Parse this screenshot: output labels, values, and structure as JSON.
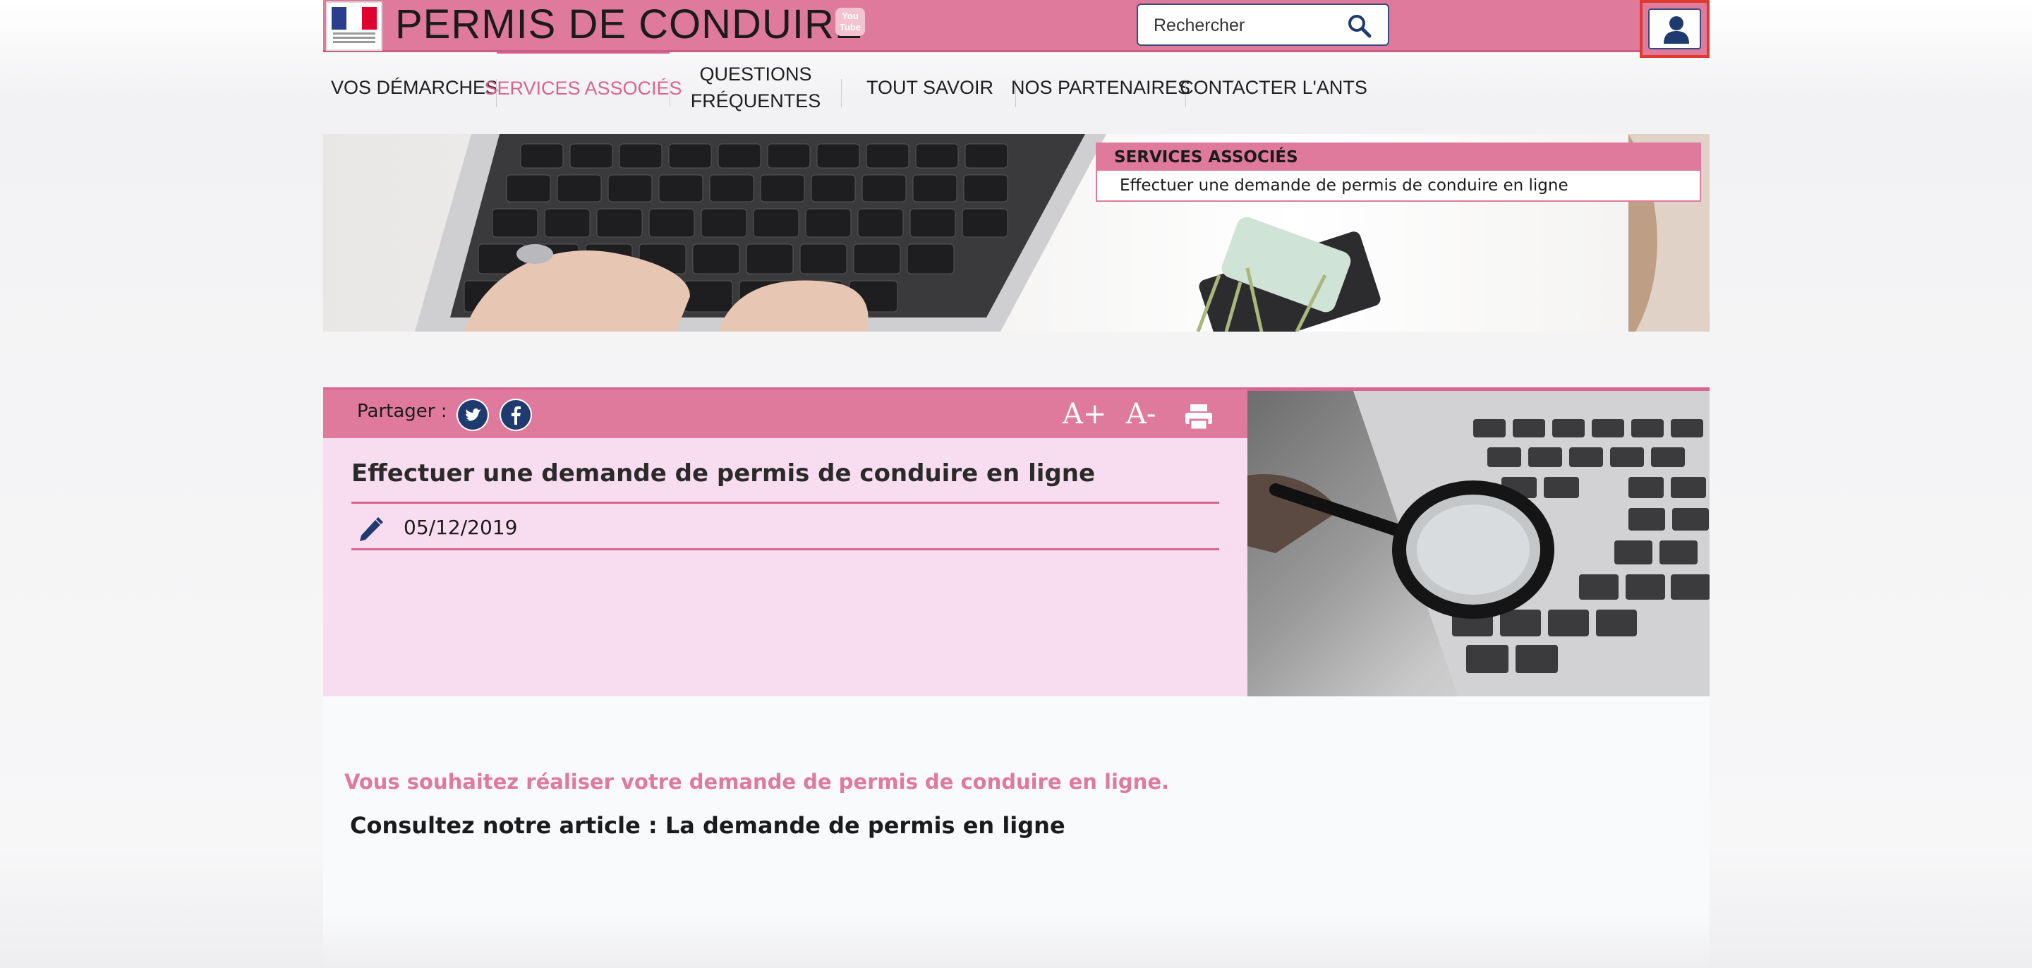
{
  "header": {
    "logo_alt": "Agence Nationale des Titres Sécurisés",
    "site_title": "PERMIS DE CONDUIRE",
    "youtube_label": "You\nTube",
    "search_placeholder": "Rechercher"
  },
  "nav": {
    "items": [
      {
        "label": "VOS DÉMARCHES"
      },
      {
        "label": "SERVICES ASSOCIÉS"
      },
      {
        "label": "QUESTIONS\nFRÉQUENTES"
      },
      {
        "label": "TOUT SAVOIR"
      },
      {
        "label": "NOS PARTENAIRES"
      },
      {
        "label": "CONTACTER L'ANTS"
      }
    ]
  },
  "services_box": {
    "heading": "SERVICES ASSOCIÉS",
    "link": "Effectuer une demande de permis de conduire en ligne"
  },
  "article": {
    "share_label": "Partager :",
    "font_increase": "A+",
    "font_decrease": "A-",
    "title": "Effectuer une demande de permis de conduire en ligne",
    "date": "05/12/2019"
  },
  "content": {
    "lead": "Vous souhaitez réaliser votre demande de permis de conduire en ligne.",
    "consult_label": "Consultez notre article : ",
    "consult_link": "La demande de permis en ligne"
  },
  "colors": {
    "brand_pink": "#df7a9c",
    "light_pink": "#f8dcef",
    "navy": "#1f3a6e",
    "highlight_border": "#e03a2e"
  }
}
